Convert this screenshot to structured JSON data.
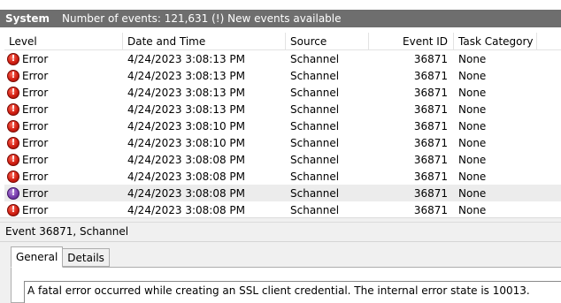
{
  "header": {
    "log_name": "System",
    "info": "Number of events: 121,631 (!) New events available"
  },
  "columns": {
    "level": "Level",
    "date": "Date and Time",
    "source": "Source",
    "event_id": "Event ID",
    "task": "Task Category"
  },
  "events": [
    {
      "level": "Error",
      "date": "4/24/2023 3:08:13 PM",
      "source": "Schannel",
      "event_id": "36871",
      "task": "None"
    },
    {
      "level": "Error",
      "date": "4/24/2023 3:08:13 PM",
      "source": "Schannel",
      "event_id": "36871",
      "task": "None"
    },
    {
      "level": "Error",
      "date": "4/24/2023 3:08:13 PM",
      "source": "Schannel",
      "event_id": "36871",
      "task": "None"
    },
    {
      "level": "Error",
      "date": "4/24/2023 3:08:13 PM",
      "source": "Schannel",
      "event_id": "36871",
      "task": "None"
    },
    {
      "level": "Error",
      "date": "4/24/2023 3:08:10 PM",
      "source": "Schannel",
      "event_id": "36871",
      "task": "None"
    },
    {
      "level": "Error",
      "date": "4/24/2023 3:08:10 PM",
      "source": "Schannel",
      "event_id": "36871",
      "task": "None"
    },
    {
      "level": "Error",
      "date": "4/24/2023 3:08:08 PM",
      "source": "Schannel",
      "event_id": "36871",
      "task": "None"
    },
    {
      "level": "Error",
      "date": "4/24/2023 3:08:08 PM",
      "source": "Schannel",
      "event_id": "36871",
      "task": "None"
    },
    {
      "level": "Error",
      "date": "4/24/2023 3:08:08 PM",
      "source": "Schannel",
      "event_id": "36871",
      "task": "None"
    },
    {
      "level": "Error",
      "date": "4/24/2023 3:08:08 PM",
      "source": "Schannel",
      "event_id": "36871",
      "task": "None"
    }
  ],
  "icons": {
    "error": "error-icon"
  },
  "details": {
    "title": "Event 36871, Schannel",
    "tabs": [
      "General",
      "Details"
    ],
    "message": "A fatal error occurred while creating an SSL client credential. The internal error state is 10013."
  }
}
